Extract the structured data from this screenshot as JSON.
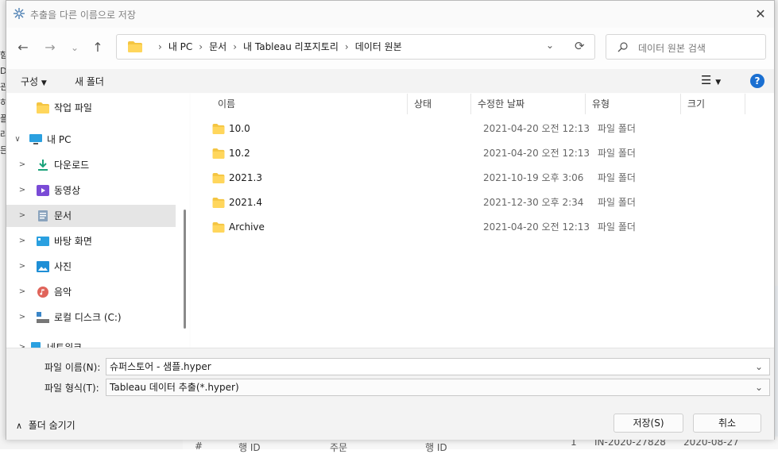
{
  "dialog": {
    "title": "추출을 다른 이름으로 저장",
    "close_icon": "✕"
  },
  "nav": {
    "back_icon": "←",
    "forward_icon": "→",
    "recent_icon": "⌄",
    "up_icon": "↑",
    "breadcrumbs": [
      "내 PC",
      "문서",
      "내 Tableau 리포지토리",
      "데이터 원본"
    ],
    "refresh_icon": "⟳"
  },
  "search": {
    "placeholder": "데이터 원본 검색"
  },
  "toolbar": {
    "organize": "구성",
    "new_folder": "새 폴더",
    "help": "?"
  },
  "sidebar": {
    "items": [
      {
        "label": "작업 파일",
        "icon": "folder-icon",
        "expanded": false,
        "chevron": ""
      },
      {
        "label": "내 PC",
        "icon": "computer-icon",
        "chevron": "∨"
      },
      {
        "label": "다운로드",
        "icon": "download-icon",
        "chevron": ">"
      },
      {
        "label": "동영상",
        "icon": "video-icon",
        "chevron": ">"
      },
      {
        "label": "문서",
        "icon": "document-icon",
        "chevron": ">",
        "selected": true
      },
      {
        "label": "바탕 화면",
        "icon": "desktop-icon",
        "chevron": ">"
      },
      {
        "label": "사진",
        "icon": "picture-icon",
        "chevron": ">"
      },
      {
        "label": "음악",
        "icon": "music-icon",
        "chevron": ">"
      },
      {
        "label": "로컬 디스크 (C:)",
        "icon": "drive-icon",
        "chevron": ">"
      },
      {
        "label": "네트워크",
        "icon": "network-icon",
        "chevron": ">"
      }
    ]
  },
  "filelist": {
    "columns": [
      "이름",
      "상태",
      "수정한 날짜",
      "유형",
      "크기"
    ],
    "rows": [
      {
        "name": "10.0",
        "modified": "2021-04-20 오전 12:13",
        "type": "파일 폴더"
      },
      {
        "name": "10.2",
        "modified": "2021-04-20 오전 12:13",
        "type": "파일 폴더"
      },
      {
        "name": "2021.3",
        "modified": "2021-10-19 오후 3:06",
        "type": "파일 폴더"
      },
      {
        "name": "2021.4",
        "modified": "2021-12-30 오후 2:34",
        "type": "파일 폴더"
      },
      {
        "name": "Archive",
        "modified": "2021-04-20 오전 12:13",
        "type": "파일 폴더"
      }
    ]
  },
  "form": {
    "filename_label": "파일 이름(N):",
    "filename_value": "슈퍼스토어 - 샘플.hyper",
    "filetype_label": "파일 형식(T):",
    "filetype_value": "Tableau 데이터 추출(*.hyper)"
  },
  "footer": {
    "hide_folders": "폴더 숨기기",
    "save": "저장(S)",
    "cancel": "취소"
  },
  "background": {
    "left_fragments": [
      "함",
      "D",
      "관",
      "히",
      "플",
      "라",
      "든"
    ],
    "bottom_fragments": [
      "#",
      "행 ID",
      "주문",
      "행 ID",
      "1",
      "IN-2020-27828",
      "2020-08-27"
    ]
  }
}
